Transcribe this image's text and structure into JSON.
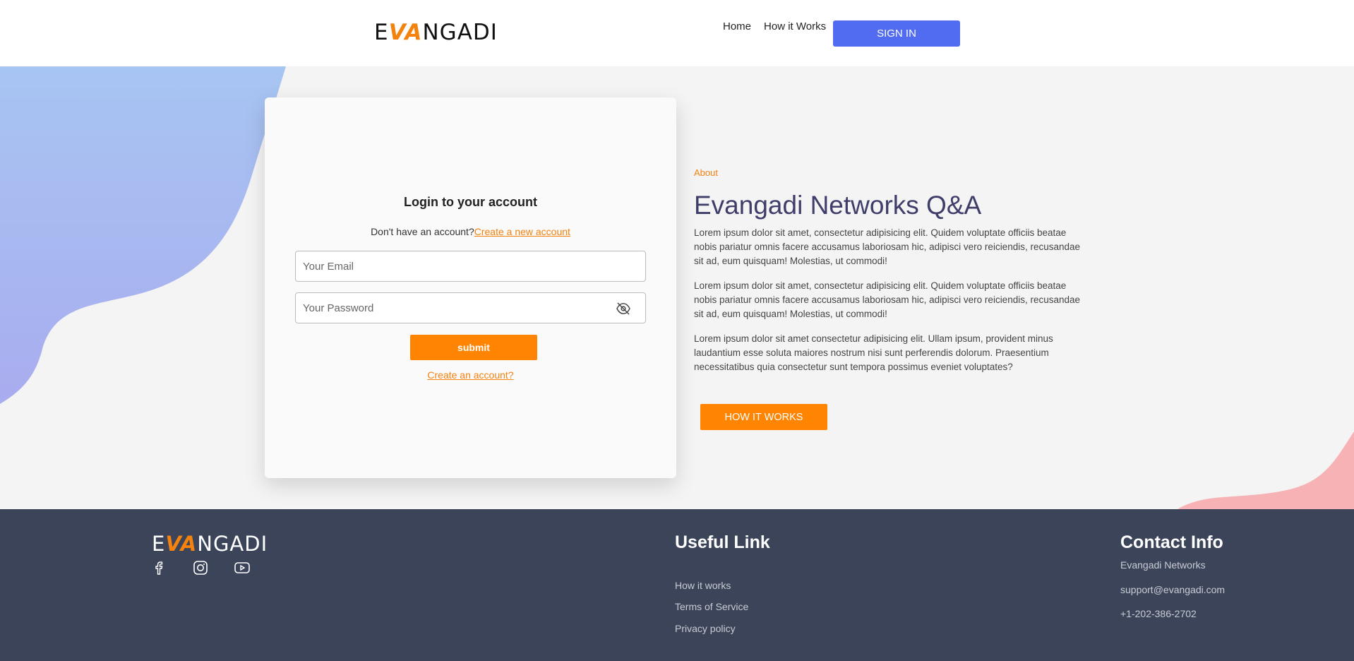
{
  "header": {
    "logo_prefix": "E",
    "logo_accent": "VA",
    "logo_suffix": "NGADI",
    "nav": [
      "Home",
      "How it Works"
    ],
    "signin_label": "SIGN IN"
  },
  "login": {
    "title": "Login to your account",
    "subtitle_prefix": "Don't have an account?",
    "subtitle_link": "Create a new account",
    "email_placeholder": "Your Email",
    "password_placeholder": "Your Password",
    "submit_label": "submit",
    "create_link": "Create an account?"
  },
  "about": {
    "tag": "About",
    "title": "Evangadi Networks Q&A",
    "paragraphs": [
      "Lorem ipsum dolor sit amet, consectetur adipisicing elit. Quidem voluptate officiis beatae nobis pariatur omnis facere accusamus laboriosam hic, adipisci vero reiciendis, recusandae sit ad, eum quisquam! Molestias, ut commodi!",
      "Lorem ipsum dolor sit amet, consectetur adipisicing elit. Quidem voluptate officiis beatae nobis pariatur omnis facere accusamus laboriosam hic, adipisci vero reiciendis, recusandae sit ad, eum quisquam! Molestias, ut commodi!",
      "Lorem ipsum dolor sit amet consectetur adipisicing elit. Ullam ipsum, provident minus laudantium esse soluta maiores nostrum nisi sunt perferendis dolorum. Praesentium necessitatibus quia consectetur sunt tempora possimus eveniet voluptates?"
    ],
    "button_label": "HOW IT WORKS"
  },
  "footer": {
    "social_icons": [
      "facebook-icon",
      "instagram-icon",
      "youtube-icon"
    ],
    "useful_title": "Useful Link",
    "useful_links": [
      "How it works",
      "Terms of Service",
      "Privacy policy"
    ],
    "contact_title": "Contact Info",
    "contact": [
      "Evangadi Networks",
      "support@evangadi.com",
      "+1-202-386-2702"
    ]
  },
  "colors": {
    "accent": "#fe8402",
    "primary_button": "#516cf0",
    "footer_bg": "#3b4459",
    "title": "#3f3d6a"
  }
}
